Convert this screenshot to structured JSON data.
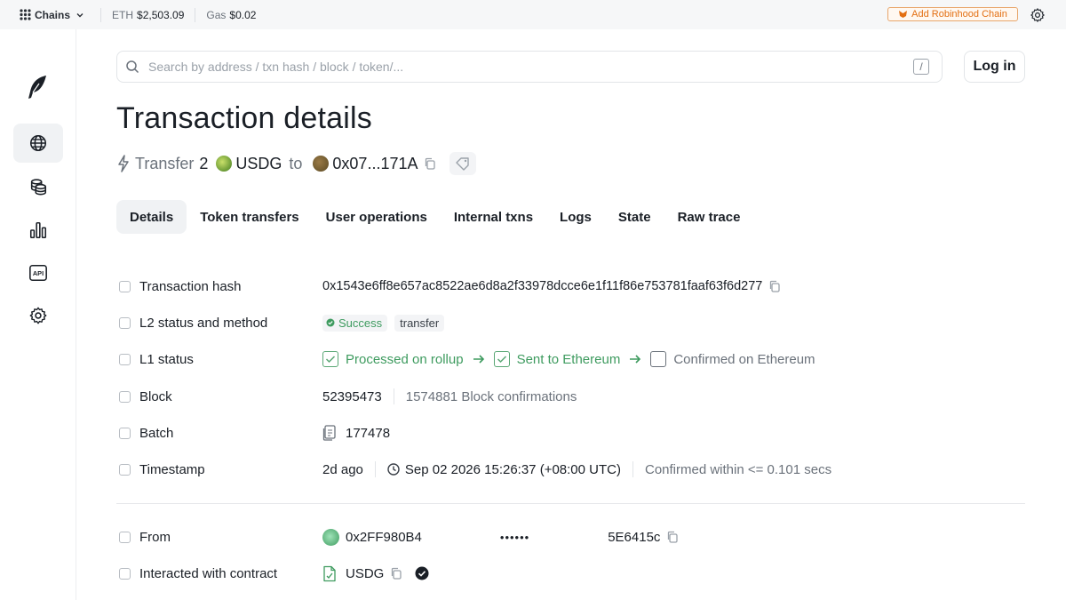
{
  "topbar": {
    "chains_label": "Chains",
    "eth_label": "ETH",
    "eth_price": "$2,503.09",
    "gas_label": "Gas",
    "gas_price": "$0.02",
    "add_chain_label": "Add Robinhood Chain"
  },
  "sidebar": {
    "items": [
      "globe-icon",
      "coins-icon",
      "chart-icon",
      "api-icon",
      "settings-icon"
    ],
    "api_text": "API"
  },
  "search": {
    "placeholder": "Search by address / txn hash / block / token/...",
    "shortcut": "/"
  },
  "login_label": "Log in",
  "page_title": "Transaction details",
  "summary": {
    "action": "Transfer",
    "amount": "2",
    "token": "USDG",
    "to_word": "to",
    "recipient": "0x07...171A"
  },
  "tabs": [
    "Details",
    "Token transfers",
    "User operations",
    "Internal txns",
    "Logs",
    "State",
    "Raw trace"
  ],
  "details": {
    "tx_hash_label": "Transaction hash",
    "tx_hash": "0x1543e6ff8e657ac8522ae6d8a2f33978dcce6e1f11f86e753781faaf63f6d277",
    "l2_label": "L2 status and method",
    "l2_status": "Success",
    "l2_method": "transfer",
    "l1_label": "L1 status",
    "l1_steps": [
      "Processed on rollup",
      "Sent to Ethereum",
      "Confirmed on Ethereum"
    ],
    "block_label": "Block",
    "block": "52395473",
    "block_confirmations": "1574881 Block confirmations",
    "batch_label": "Batch",
    "batch": "177478",
    "timestamp_label": "Timestamp",
    "timestamp_ago": "2d ago",
    "timestamp_full": "Sep 02 2026 15:26:37 (+08:00 UTC)",
    "timestamp_confirmed": "Confirmed within <= 0.101 secs",
    "from_label": "From",
    "from_start": "0x2FF980B4",
    "from_dots": "••••••",
    "from_end": "5E6415c",
    "contract_label": "Interacted with contract",
    "contract": "USDG"
  },
  "colors": {
    "accent_green": "#3e9b5f",
    "orange": "#e36f12"
  }
}
